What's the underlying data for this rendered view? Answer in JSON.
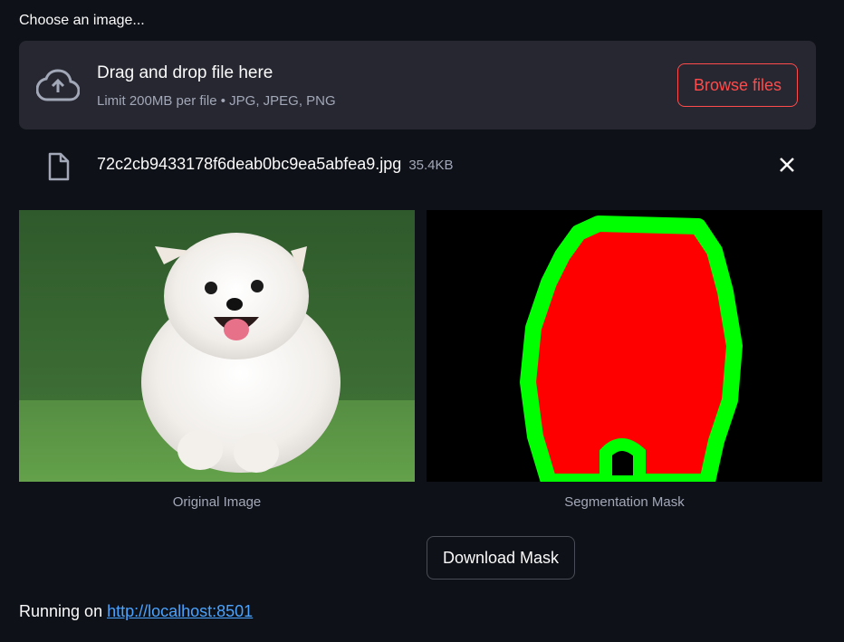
{
  "uploader": {
    "label": "Choose an image...",
    "drop_title": "Drag and drop file here",
    "drop_limit": "Limit 200MB per file • JPG, JPEG, PNG",
    "browse_label": "Browse files"
  },
  "file": {
    "name": "72c2cb9433178f6deab0bc9ea5abfea9.jpg",
    "size": "35.4KB"
  },
  "images": {
    "original_caption": "Original Image",
    "mask_caption": "Segmentation Mask"
  },
  "download": {
    "label": "Download Mask"
  },
  "footer": {
    "prefix": "Running on ",
    "link": "http://localhost:8501"
  },
  "colors": {
    "accent": "#ff4b4b",
    "mask_fill": "#ff0000",
    "mask_outline": "#00ff00",
    "link": "#4aa3ff"
  },
  "icons": {
    "upload": "cloud-upload-icon",
    "file": "file-icon",
    "close": "close-icon"
  }
}
